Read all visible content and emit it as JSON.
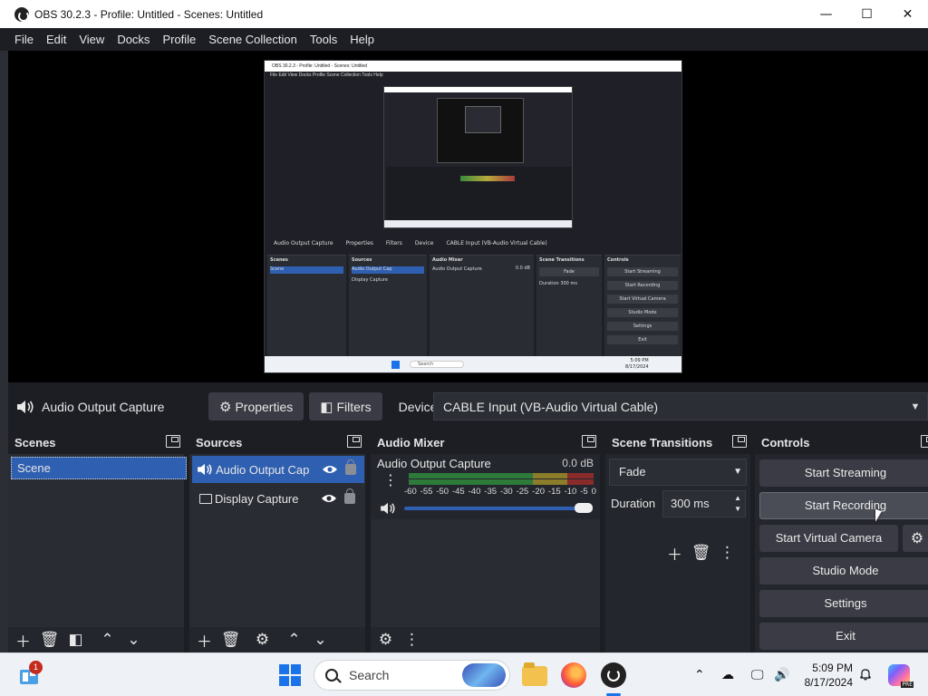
{
  "window": {
    "title": "OBS 30.2.3 - Profile: Untitled - Scenes: Untitled",
    "minimize": "—",
    "maximize": "☐",
    "close": "✕"
  },
  "menu": [
    "File",
    "Edit",
    "View",
    "Docks",
    "Profile",
    "Scene Collection",
    "Tools",
    "Help"
  ],
  "preview": {
    "title": "OBS 30.2.3 - Profile: Untitled - Scenes: Untitled",
    "menu": "File   Edit   View   Docks   Profile   Scene Collection   Tools   Help",
    "source_bar": [
      "Audio Output Capture",
      "Properties",
      "Filters",
      "Device",
      "CABLE Input (VB-Audio Virtual Cable)"
    ],
    "docks": {
      "scenes": "Scenes",
      "scene_item": "Scene",
      "sources": "Sources",
      "source_a": "Audio Output Cap",
      "source_b": "Display Capture",
      "mixer": "Audio Mixer",
      "mixer_channel": "Audio Output Capture",
      "mixer_db": "0.0 dB",
      "transitions": "Scene Transitions",
      "transition": "Fade",
      "duration_label": "Duration",
      "duration": "300 ms",
      "controls": "Controls",
      "buttons": [
        "Start Streaming",
        "Start Recording",
        "Start Virtual Camera",
        "Studio Mode",
        "Settings",
        "Exit"
      ]
    },
    "taskbar": {
      "search": "Search",
      "time": "5:09 PM",
      "date": "8/17/2024"
    }
  },
  "source_toolbar": {
    "source_name": "Audio Output Capture",
    "properties": "Properties",
    "filters": "Filters",
    "device_label": "Device",
    "device_value": "CABLE Input (VB-Audio Virtual Cable)"
  },
  "scenes": {
    "title": "Scenes",
    "items": [
      "Scene"
    ]
  },
  "sources": {
    "title": "Sources",
    "items": [
      {
        "name": "Audio Output Cap",
        "selected": true
      },
      {
        "name": "Display Capture",
        "selected": false
      }
    ]
  },
  "mixer": {
    "title": "Audio Mixer",
    "channel": "Audio Output Capture",
    "level": "0.0 dB",
    "scale": [
      "-60",
      "-55",
      "-50",
      "-45",
      "-40",
      "-35",
      "-30",
      "-25",
      "-20",
      "-15",
      "-10",
      "-5",
      "0"
    ],
    "volume": 1.0,
    "colors": {
      "green": "#2d7a3a",
      "yellow": "#8c7d2a",
      "red": "#8a2b2b"
    }
  },
  "transitions": {
    "title": "Scene Transitions",
    "selected": "Fade",
    "duration_label": "Duration",
    "duration": "300 ms"
  },
  "controls": {
    "title": "Controls",
    "start_streaming": "Start Streaming",
    "start_recording": "Start Recording",
    "start_virtual_camera": "Start Virtual Camera",
    "studio_mode": "Studio Mode",
    "settings": "Settings",
    "exit": "Exit"
  },
  "taskbar": {
    "badge": "1",
    "search_placeholder": "Search",
    "time": "5:09 PM",
    "date": "8/17/2024",
    "copilot_tag": "PRE"
  },
  "theme": {
    "accent": "#2f5fb0",
    "background": "#1d1e24",
    "panel": "#2a2c34",
    "button": "#3a3b44"
  }
}
